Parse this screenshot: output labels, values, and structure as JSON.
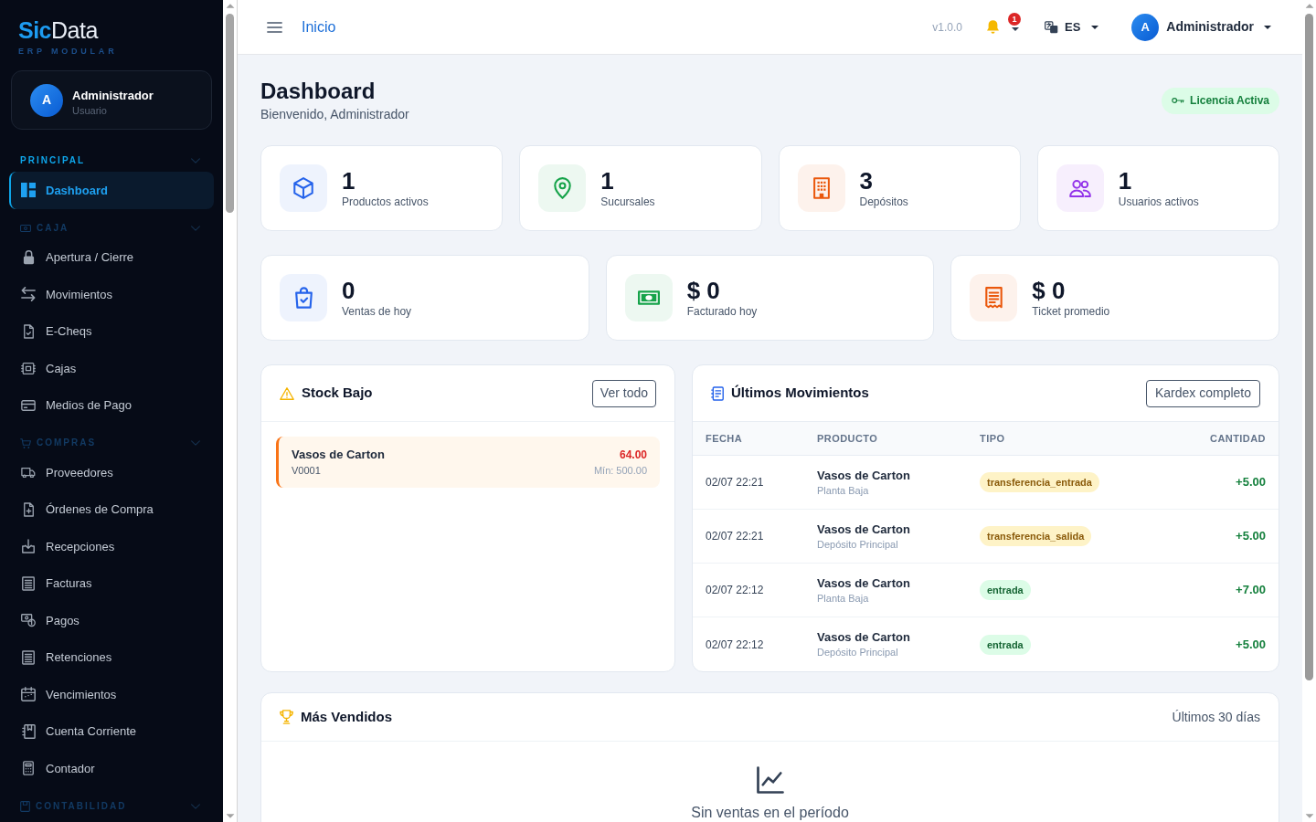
{
  "sidebar": {
    "logo": "**Sic**Data",
    "tagline": "ERP MODULAR",
    "user": {
      "avatar": "A",
      "name": "Administrador",
      "role": "Usuario"
    },
    "sections": [
      {
        "label": "PRINCIPAL",
        "items": [
          {
            "label": "Dashboard",
            "selected": true
          }
        ]
      },
      {
        "label": "CAJA",
        "items": [
          {
            "label": "Apertura / Cierre",
            "selected": false
          },
          {
            "label": "Movimientos",
            "selected": false
          },
          {
            "label": "E-Cheqs",
            "selected": false
          },
          {
            "label": "Cajas",
            "selected": false
          },
          {
            "label": "Medios de Pago",
            "selected": false
          }
        ]
      },
      {
        "label": "COMPRAS",
        "items": [
          {
            "label": "Proveedores",
            "selected": false
          },
          {
            "label": "Órdenes de Compra",
            "selected": false
          },
          {
            "label": "Recepciones",
            "selected": false
          },
          {
            "label": "Facturas",
            "selected": false
          },
          {
            "label": "Pagos",
            "selected": false
          },
          {
            "label": "Retenciones",
            "selected": false
          },
          {
            "label": "Vencimientos",
            "selected": false
          },
          {
            "label": "Cuenta Corriente",
            "selected": false
          },
          {
            "label": "Contador",
            "selected": false
          }
        ]
      },
      {
        "label": "CONTABILIDAD"
      }
    ]
  },
  "topbar": {
    "breadcrumb": "Inicio",
    "version": "v1.0.0",
    "notifications": "1",
    "language": "ES",
    "user": {
      "avatar": "A",
      "name": "Administrador"
    }
  },
  "header": {
    "title": "Dashboard",
    "subtitle": "Bienvenido, Administrador",
    "license": "Licencia Activa"
  },
  "stat_cards_row_1": [
    {
      "value": "1",
      "label": "Productos activos",
      "color": "#2563eb"
    },
    {
      "value": "1",
      "label": "Sucursales",
      "color": "#16a34a"
    },
    {
      "value": "3",
      "label": "Depósitos",
      "color": "#ea580c"
    },
    {
      "value": "1",
      "label": "Usuarios activos",
      "color": "#9333ea"
    }
  ],
  "stat_cards_row_2": [
    {
      "value": "0",
      "label": "Ventas de hoy",
      "color": "#2563eb"
    },
    {
      "value": "$ 0",
      "label": "Facturado hoy",
      "color": "#16a34a"
    },
    {
      "value": "$ 0",
      "label": "Ticket promedio",
      "color": "#ea580c"
    }
  ],
  "low_stock": {
    "title": "Stock Bajo",
    "button": "Ver todo",
    "items": [
      {
        "name": "Vasos de Carton",
        "code": "V0001",
        "stock": "64.00",
        "minimum": "Mín: 500.00"
      }
    ]
  },
  "movements": {
    "title": "Últimos Movimientos",
    "button": "Kardex completo",
    "columns": [
      "FECHA",
      "PRODUCTO",
      "TIPO",
      "CANTIDAD"
    ],
    "rows": [
      {
        "date": "02/07 22:21",
        "product": "Vasos de Carton",
        "location": "Planta Baja",
        "type": {
          "text": "transferencia_entrada",
          "kind": "warning"
        },
        "quantity": "+5.00"
      },
      {
        "date": "02/07 22:21",
        "product": "Vasos de Carton",
        "location": "Depósito Principal",
        "type": {
          "text": "transferencia_salida",
          "kind": "warning"
        },
        "quantity": "+5.00"
      },
      {
        "date": "02/07 22:12",
        "product": "Vasos de Carton",
        "location": "Planta Baja",
        "type": {
          "text": "entrada",
          "kind": "success"
        },
        "quantity": "+7.00"
      },
      {
        "date": "02/07 22:12",
        "product": "Vasos de Carton",
        "location": "Depósito Principal",
        "type": {
          "text": "entrada",
          "kind": "success"
        },
        "quantity": "+5.00"
      }
    ]
  },
  "top_sellers": {
    "title": "Más Vendidos",
    "period": "Últimos 30 días",
    "empty_message": "Sin ventas en el período"
  }
}
